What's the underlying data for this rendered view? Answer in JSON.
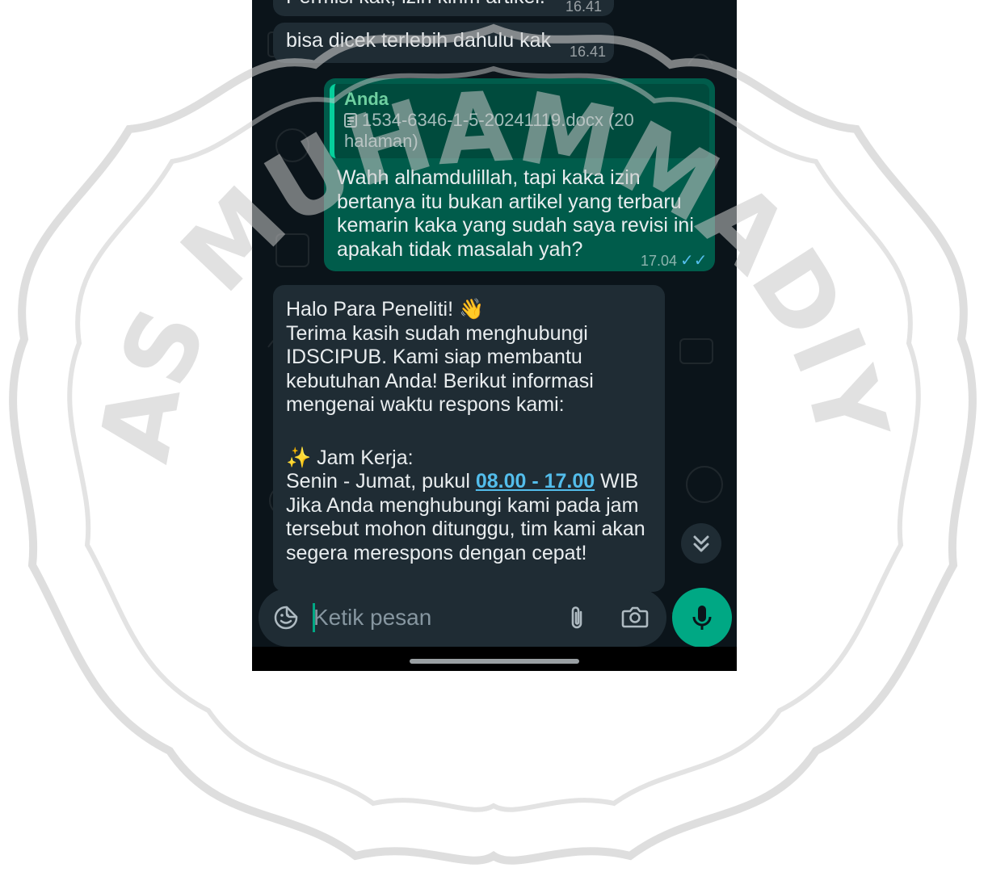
{
  "chat": {
    "messages": [
      {
        "id": "m1",
        "direction": "incoming",
        "text": "Permisi kak, izin kirim artikel.",
        "time": "16.41"
      },
      {
        "id": "m2",
        "direction": "incoming",
        "text": "bisa dicek terlebih dahulu kak",
        "time": "16.41"
      },
      {
        "id": "m3",
        "direction": "outgoing",
        "reply": {
          "author": "Anda",
          "document": "1534-6346-1-5-20241119.docx (20 halaman)"
        },
        "lines": [
          "Wahh alhamdulillah, tapi kaka izin",
          "bertanya itu bukan artikel yang terbaru",
          "kemarin kaka yang sudah saya revisi ini",
          "apakah tidak masalah yah?"
        ],
        "time": "17.04",
        "status": "read"
      },
      {
        "id": "m4",
        "direction": "incoming",
        "greeting": "Halo Para Peneliti! 👋",
        "para1": [
          "Terima kasih sudah menghubungi",
          "IDSCIPUB. Kami siap membantu",
          "kebutuhan Anda! Berikut informasi",
          "mengenai waktu respons kami:"
        ],
        "hours_title": "✨ Jam Kerja:",
        "hours_prefix": "Senin - Jumat, pukul ",
        "hours_link": "08.00 - 17.00",
        "hours_suffix": " WIB",
        "para2": [
          "Jika Anda menghubungi kami pada jam",
          "tersebut mohon ditunggu, tim kami akan",
          "segera merespons dengan cepat!"
        ]
      }
    ]
  },
  "composer": {
    "placeholder": "Ketik pesan"
  },
  "icons": {
    "emoji": "sticker-icon",
    "attach": "paperclip-icon",
    "camera": "camera-icon",
    "mic": "mic-icon",
    "scroll": "double-chevron-down-icon"
  },
  "watermark": {
    "text": "UNIVERSITAS MUHAMMADIYAH JEMBER"
  },
  "colors": {
    "background": "#0b141a",
    "incoming_bubble": "#1f2c34",
    "outgoing_bubble": "#005c4b",
    "accent": "#00a884",
    "link": "#53bdeb",
    "read_ticks": "#53bdeb"
  }
}
